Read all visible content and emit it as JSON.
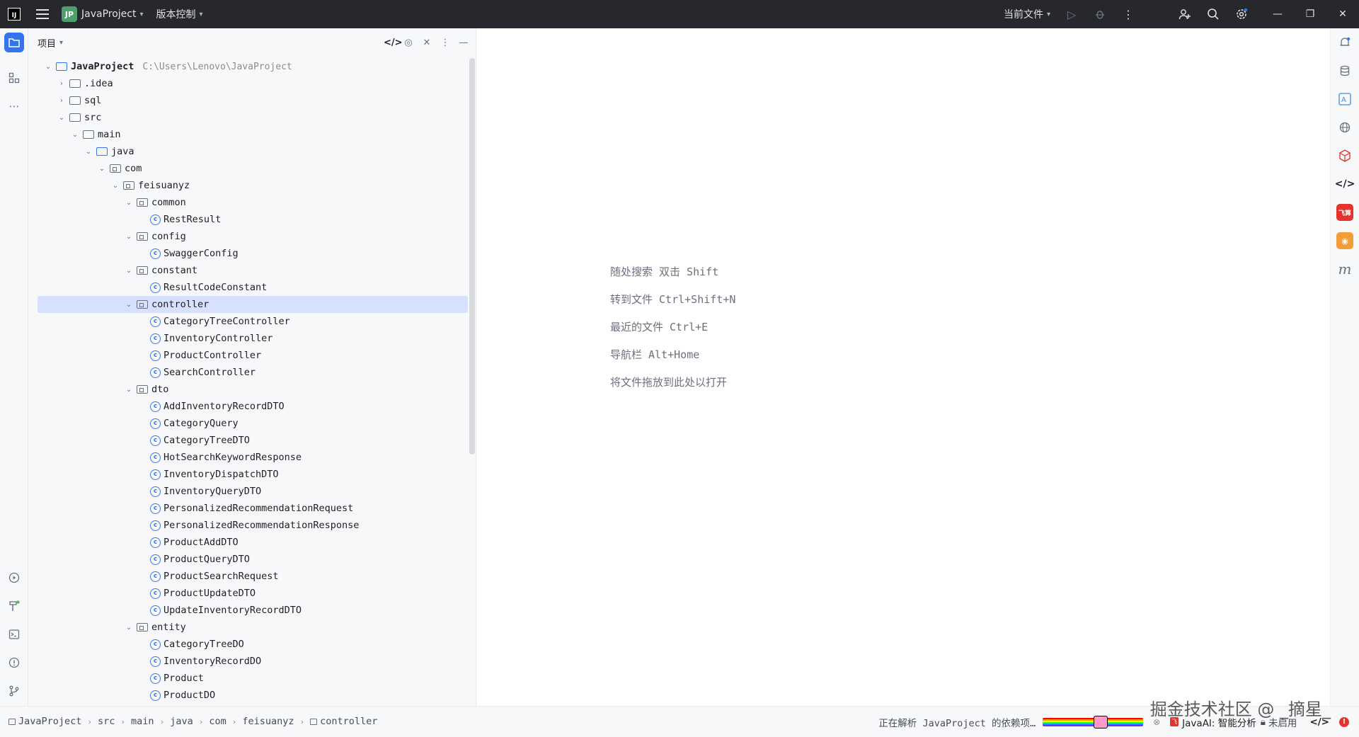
{
  "titlebar": {
    "project_badge": "JP",
    "project_name": "JavaProject",
    "vcs_menu": "版本控制",
    "run_config": "当前文件"
  },
  "panel": {
    "title": "项目"
  },
  "tree": [
    {
      "label": "JavaProject",
      "path": "C:\\Users\\Lenovo\\JavaProject",
      "indent": 0,
      "chevron": "open",
      "icon": "module-folder",
      "bold": true
    },
    {
      "label": ".idea",
      "indent": 1,
      "chevron": "closed",
      "icon": "folder"
    },
    {
      "label": "sql",
      "indent": 1,
      "chevron": "closed",
      "icon": "folder"
    },
    {
      "label": "src",
      "indent": 1,
      "chevron": "open",
      "icon": "folder"
    },
    {
      "label": "main",
      "indent": 2,
      "chevron": "open",
      "icon": "folder"
    },
    {
      "label": "java",
      "indent": 3,
      "chevron": "open",
      "icon": "source-folder"
    },
    {
      "label": "com",
      "indent": 4,
      "chevron": "open",
      "icon": "package"
    },
    {
      "label": "feisuanyz",
      "indent": 5,
      "chevron": "open",
      "icon": "package"
    },
    {
      "label": "common",
      "indent": 6,
      "chevron": "open",
      "icon": "package"
    },
    {
      "label": "RestResult",
      "indent": 7,
      "chevron": "none",
      "icon": "class"
    },
    {
      "label": "config",
      "indent": 6,
      "chevron": "open",
      "icon": "package"
    },
    {
      "label": "SwaggerConfig",
      "indent": 7,
      "chevron": "none",
      "icon": "class"
    },
    {
      "label": "constant",
      "indent": 6,
      "chevron": "open",
      "icon": "package"
    },
    {
      "label": "ResultCodeConstant",
      "indent": 7,
      "chevron": "none",
      "icon": "class"
    },
    {
      "label": "controller",
      "indent": 6,
      "chevron": "open",
      "icon": "package",
      "selected": true
    },
    {
      "label": "CategoryTreeController",
      "indent": 7,
      "chevron": "none",
      "icon": "class"
    },
    {
      "label": "InventoryController",
      "indent": 7,
      "chevron": "none",
      "icon": "class"
    },
    {
      "label": "ProductController",
      "indent": 7,
      "chevron": "none",
      "icon": "class"
    },
    {
      "label": "SearchController",
      "indent": 7,
      "chevron": "none",
      "icon": "class"
    },
    {
      "label": "dto",
      "indent": 6,
      "chevron": "open",
      "icon": "package"
    },
    {
      "label": "AddInventoryRecordDTO",
      "indent": 7,
      "chevron": "none",
      "icon": "class"
    },
    {
      "label": "CategoryQuery",
      "indent": 7,
      "chevron": "none",
      "icon": "class"
    },
    {
      "label": "CategoryTreeDTO",
      "indent": 7,
      "chevron": "none",
      "icon": "class"
    },
    {
      "label": "HotSearchKeywordResponse",
      "indent": 7,
      "chevron": "none",
      "icon": "class"
    },
    {
      "label": "InventoryDispatchDTO",
      "indent": 7,
      "chevron": "none",
      "icon": "class"
    },
    {
      "label": "InventoryQueryDTO",
      "indent": 7,
      "chevron": "none",
      "icon": "class"
    },
    {
      "label": "PersonalizedRecommendationRequest",
      "indent": 7,
      "chevron": "none",
      "icon": "class"
    },
    {
      "label": "PersonalizedRecommendationResponse",
      "indent": 7,
      "chevron": "none",
      "icon": "class"
    },
    {
      "label": "ProductAddDTO",
      "indent": 7,
      "chevron": "none",
      "icon": "class"
    },
    {
      "label": "ProductQueryDTO",
      "indent": 7,
      "chevron": "none",
      "icon": "class"
    },
    {
      "label": "ProductSearchRequest",
      "indent": 7,
      "chevron": "none",
      "icon": "class"
    },
    {
      "label": "ProductUpdateDTO",
      "indent": 7,
      "chevron": "none",
      "icon": "class"
    },
    {
      "label": "UpdateInventoryRecordDTO",
      "indent": 7,
      "chevron": "none",
      "icon": "class"
    },
    {
      "label": "entity",
      "indent": 6,
      "chevron": "open",
      "icon": "package"
    },
    {
      "label": "CategoryTreeDO",
      "indent": 7,
      "chevron": "none",
      "icon": "class"
    },
    {
      "label": "InventoryRecordDO",
      "indent": 7,
      "chevron": "none",
      "icon": "class"
    },
    {
      "label": "Product",
      "indent": 7,
      "chevron": "none",
      "icon": "class"
    },
    {
      "label": "ProductDO",
      "indent": 7,
      "chevron": "none",
      "icon": "class"
    }
  ],
  "editor_hints": [
    "随处搜索 双击 Shift",
    "转到文件 Ctrl+Shift+N",
    "最近的文件 Ctrl+E",
    "导航栏 Alt+Home",
    "将文件拖放到此处以打开"
  ],
  "breadcrumb": [
    "JavaProject",
    "src",
    "main",
    "java",
    "com",
    "feisuanyz",
    "controller"
  ],
  "status": {
    "task_text": "正在解析 JavaProject 的依赖项…",
    "javaai_label": "JavaAI: 智能分析",
    "javaai_state": "未启用"
  },
  "right_strip": {
    "translate_badge": "飞算",
    "m_label": "m"
  },
  "watermark": "掘金技术社区 @ _摘星_"
}
